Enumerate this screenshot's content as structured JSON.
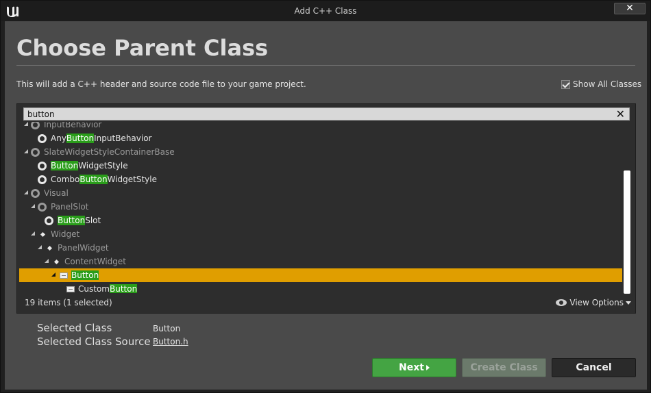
{
  "window": {
    "title": "Add C++ Class",
    "close_label": "✕"
  },
  "heading": "Choose Parent Class",
  "description": "This will add a C++ header and source code file to your game project.",
  "show_all_classes": {
    "label": "Show All Classes",
    "checked": true
  },
  "search": {
    "value": "button",
    "clear_label": "✕"
  },
  "tree": [
    {
      "prefix": "",
      "match": "",
      "suffix": "InputBehavior",
      "dim": true
    },
    {
      "prefix": "Any",
      "match": "Button",
      "suffix": "InputBehavior",
      "dim": false
    },
    {
      "prefix": "",
      "match": "",
      "suffix": "SlateWidgetStyleContainerBase",
      "dim": true
    },
    {
      "prefix": "",
      "match": "Button",
      "suffix": "WidgetStyle",
      "dim": false
    },
    {
      "prefix": "Combo",
      "match": "Button",
      "suffix": "WidgetStyle",
      "dim": false
    },
    {
      "prefix": "",
      "match": "",
      "suffix": "Visual",
      "dim": true
    },
    {
      "prefix": "",
      "match": "",
      "suffix": "PanelSlot",
      "dim": true
    },
    {
      "prefix": "",
      "match": "Button",
      "suffix": "Slot",
      "dim": false
    },
    {
      "prefix": "",
      "match": "",
      "suffix": "Widget",
      "dim": true
    },
    {
      "prefix": "",
      "match": "",
      "suffix": "PanelWidget",
      "dim": true
    },
    {
      "prefix": "",
      "match": "",
      "suffix": "ContentWidget",
      "dim": true
    },
    {
      "prefix": "",
      "match": "Button",
      "suffix": "",
      "dim": false,
      "selected": true
    },
    {
      "prefix": "Custom",
      "match": "Button",
      "suffix": "",
      "dim": false
    }
  ],
  "status": "19 items (1 selected)",
  "view_options": "View Options",
  "selected_class": {
    "label": "Selected Class",
    "value": "Button"
  },
  "selected_class_source": {
    "label": "Selected Class Source",
    "value": "Button.h"
  },
  "buttons": {
    "next": "Next",
    "create": "Create Class",
    "cancel": "Cancel"
  },
  "colors": {
    "highlight": "#2a9d1a",
    "selection": "#e09e00",
    "next_button": "#44a443"
  }
}
